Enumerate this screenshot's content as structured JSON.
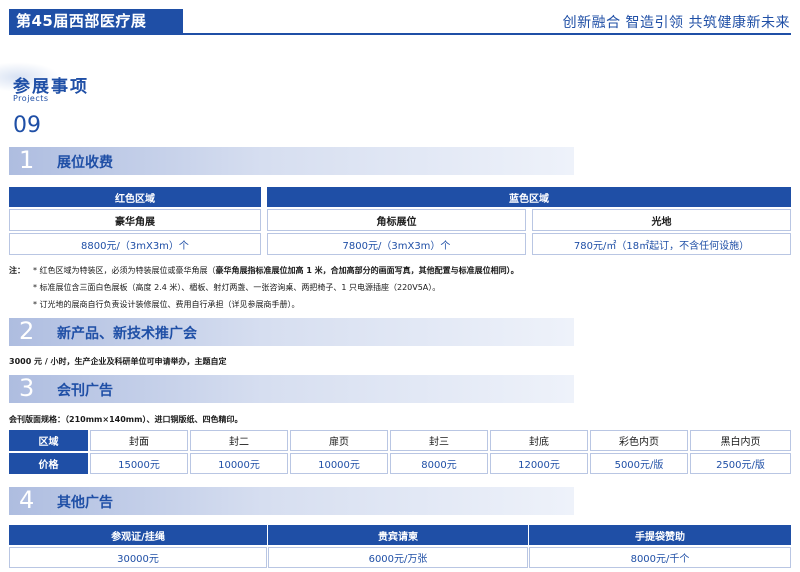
{
  "header": {
    "title": "第45届西部医疗展",
    "slogan": "创新融合 智造引领 共筑健康新未来"
  },
  "projects": {
    "title": "参展事项",
    "subtitle": "Projects",
    "number": "09"
  },
  "sections": [
    {
      "num": "1",
      "title": "展位收费"
    },
    {
      "num": "2",
      "title": "新产品、新技术推广会"
    },
    {
      "num": "3",
      "title": "会刊广告"
    },
    {
      "num": "4",
      "title": "其他广告"
    }
  ],
  "booth": {
    "red_zone": "红色区域",
    "blue_zone": "蓝色区域",
    "types": [
      "豪华角展",
      "角标展位",
      "光地"
    ],
    "prices": [
      "8800元/（3mX3m）个",
      "7800元/（3mX3m）个",
      "780元/㎡（18㎡起订，不含任何设施）"
    ]
  },
  "notes": {
    "label": "注：",
    "line1": "* 红色区域为特装区，必须为特装展位或豪华角展（",
    "line1_bold": "豪华角展指标准展位加高 1 米，合加高部分的画面写真，其他配置与标准展位相同）。",
    "line2": "* 标准展位含三面白色展板（高度 2.4 米）、楣板、射灯两盏、一张咨询桌、两把椅子、1 只电源插座（220V5A）。",
    "line3": "* 订光地的展商自行负责设计装修展位、费用自行承担（详见参展商手册）。"
  },
  "seminar": {
    "text": "3000 元 / 小时，生产企业及科研单位可申请举办，主题自定"
  },
  "catalog": {
    "spec": "会刊版面规格：（210mm×140mm）、进口铜版纸、四色精印。",
    "row_header_area": "区域",
    "row_header_price": "价格",
    "areas": [
      "封面",
      "封二",
      "扉页",
      "封三",
      "封底",
      "彩色内页",
      "黑白内页"
    ],
    "prices": [
      "15000元",
      "10000元",
      "10000元",
      "8000元",
      "12000元",
      "5000元/版",
      "2500元/版"
    ]
  },
  "other_ads": {
    "headers": [
      "参观证/挂绳",
      "贵宾请柬",
      "手提袋赞助"
    ],
    "prices": [
      "30000元",
      "6000元/万张",
      "8000元/千个"
    ]
  },
  "colors": {
    "brand_blue": "#1f4fa6",
    "cell_border": "#b9c6e3"
  }
}
